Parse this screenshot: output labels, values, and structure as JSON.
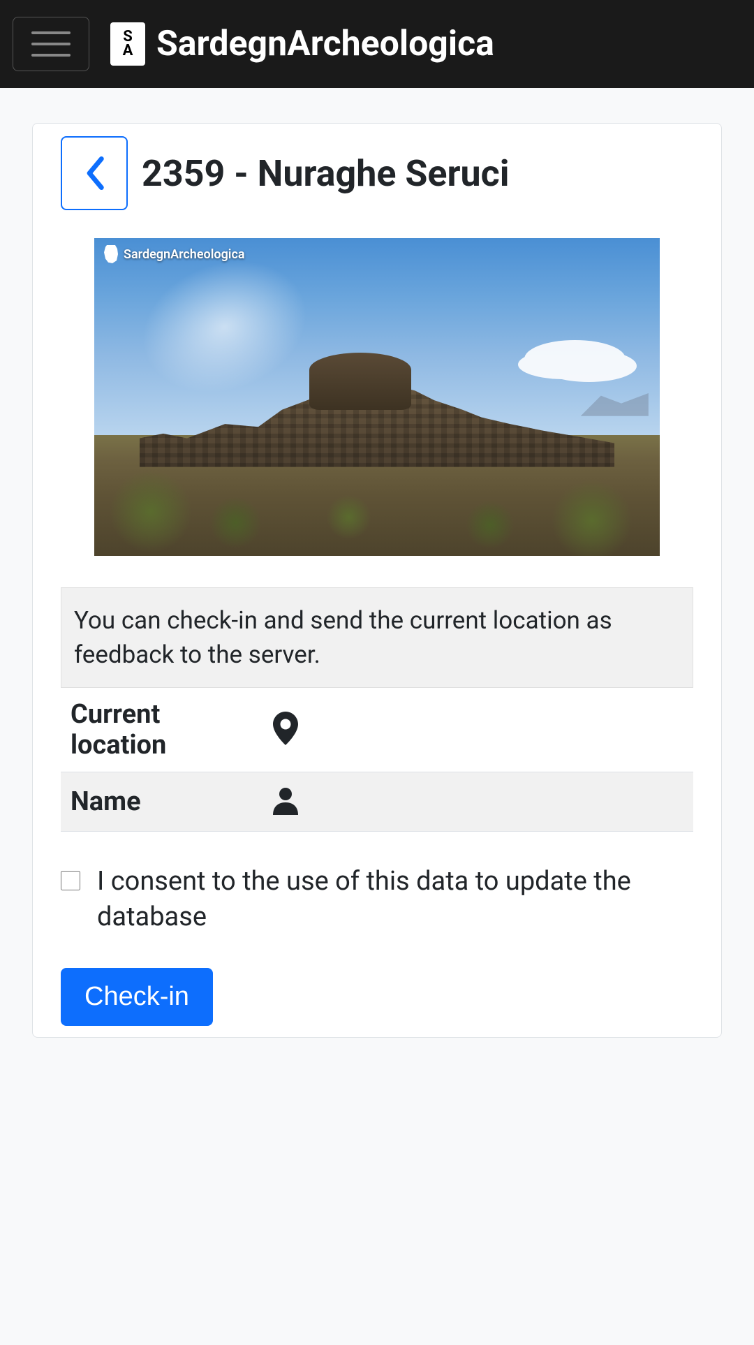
{
  "brand": {
    "name": "SardegnArcheologica",
    "logo_letters_top": "S",
    "logo_letters_bottom": "A"
  },
  "page": {
    "title": "2359 - Nuraghe Seruci"
  },
  "image": {
    "watermark": "SardegnArcheologica"
  },
  "info": {
    "checkin_description": "You can check-in and send the current location as feedback to the server."
  },
  "table": {
    "current_location_label": "Current location",
    "current_location_value": "",
    "name_label": "Name",
    "name_value": ""
  },
  "consent": {
    "label": "I consent to the use of this data to update the database",
    "checked": false
  },
  "buttons": {
    "checkin": "Check-in"
  }
}
